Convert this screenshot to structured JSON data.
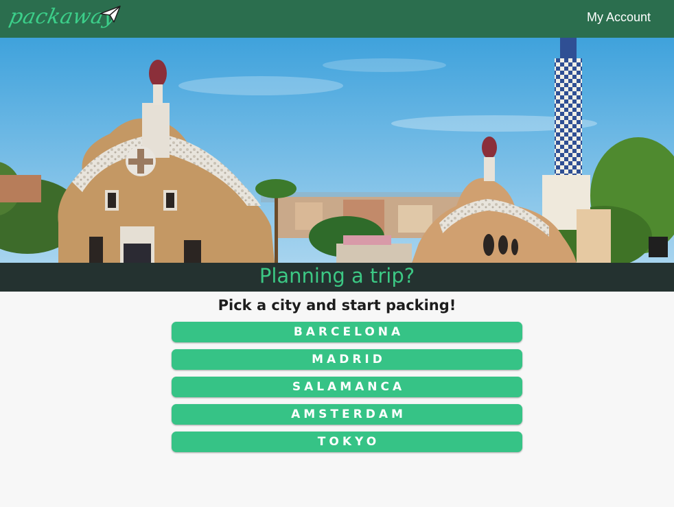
{
  "navbar": {
    "logo_text": "packaway",
    "logo_icon": "paper-plane-icon",
    "account_label": "My Account"
  },
  "hero": {
    "image": "park-guell-barcelona-photo"
  },
  "banner": {
    "title": "Planning a trip?"
  },
  "main": {
    "subtitle": "Pick a city and start packing!",
    "cities": [
      "BARCELONA",
      "MADRID",
      "SALAMANCA",
      "AMSTERDAM",
      "TOKYO"
    ]
  },
  "colors": {
    "navbar": "#2b6e4e",
    "accent": "#36c386",
    "banner_bg": "#243230",
    "banner_text": "#3cc884",
    "page_bg": "#f7f7f7"
  }
}
